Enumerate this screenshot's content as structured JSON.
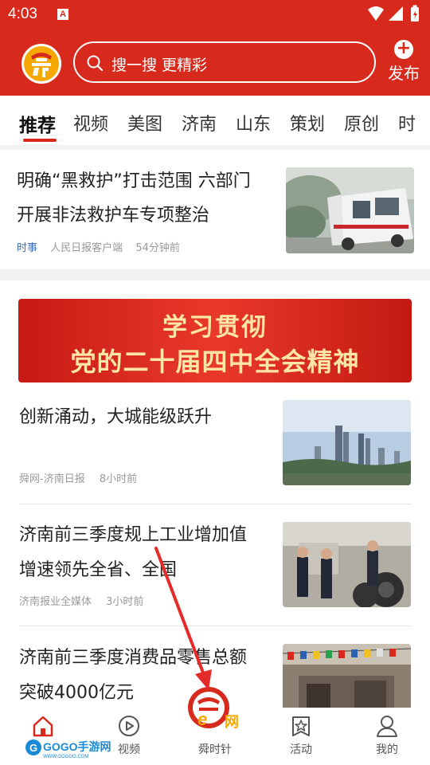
{
  "status_bar": {
    "time": "4:03",
    "notification_icon": "A"
  },
  "header": {
    "search_placeholder": "搜一搜 更精彩",
    "publish_label": "发布",
    "logo_icon": "shunwang-logo",
    "brand_color": "#d8291d"
  },
  "tabs": [
    "推荐",
    "视频",
    "美图",
    "济南",
    "山东",
    "策划",
    "原创",
    "时"
  ],
  "active_tab": "推荐",
  "feed": {
    "top_story": {
      "title_line1": "明确“黑救护”打击范围 六部门",
      "title_line2": "开展非法救护车专项整治",
      "category": "时事",
      "source": "人民日报客户端",
      "time": "54分钟前"
    },
    "banner": {
      "line1": "学习贯彻",
      "line2": "党的二十届四中全会精神"
    },
    "items": [
      {
        "title_line1": "创新涌动，大城能级跃升",
        "title_line2": "",
        "source": "舜网-济南日报",
        "time": "8小时前"
      },
      {
        "title_line1": "济南前三季度规上工业增加值",
        "title_line2": "增速领先全省、全国",
        "source": "济南报业全媒体",
        "time": "3小时前"
      },
      {
        "title_line1": "济南前三季度消费品零售总额",
        "title_line2": "突破4000亿元",
        "source": "",
        "time": ""
      }
    ]
  },
  "bottom_nav": {
    "home_label": "首页",
    "video_label": "视频",
    "center_label": "舜时针",
    "activity_label": "活动",
    "mine_label": "我的",
    "center_logo_text": "网"
  },
  "watermark": {
    "brand": "GOGO手游网",
    "url": "WWW.GOGOO.COM"
  }
}
